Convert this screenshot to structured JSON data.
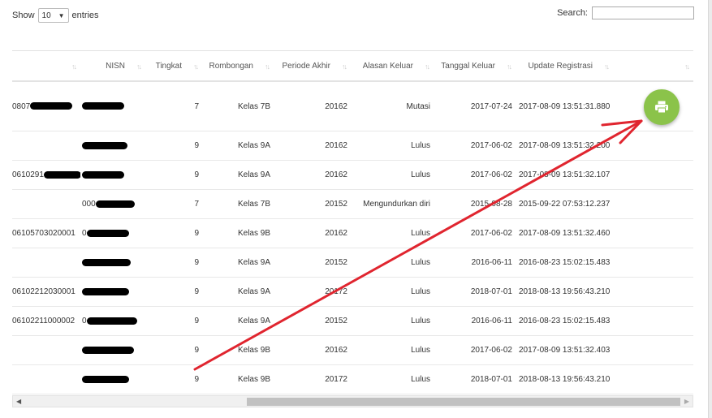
{
  "length": {
    "show_label": "Show",
    "value": "10",
    "entries_label": "entries"
  },
  "search": {
    "label": "Search:",
    "value": ""
  },
  "table": {
    "headers": [
      "",
      "NISN",
      "Tingkat",
      "Rombongan",
      "Periode Akhir",
      "Alasan Keluar",
      "Tanggal Keluar",
      "Update Registrasi",
      ""
    ],
    "rows": [
      {
        "nipd": "0807",
        "nisn": "",
        "tingkat": "7",
        "rombongan": "Kelas 7B",
        "periode": "20162",
        "alasan": "Mutasi",
        "tanggal": "2017-07-24",
        "update": "2017-08-09 13:51:31.880"
      },
      {
        "nipd": "",
        "nisn": "",
        "tingkat": "9",
        "rombongan": "Kelas 9A",
        "periode": "20162",
        "alasan": "Lulus",
        "tanggal": "2017-06-02",
        "update": "2017-08-09 13:51:32.200"
      },
      {
        "nipd": "0610291",
        "nisn": "",
        "tingkat": "9",
        "rombongan": "Kelas 9A",
        "periode": "20162",
        "alasan": "Lulus",
        "tanggal": "2017-06-02",
        "update": "2017-08-09 13:51:32.107"
      },
      {
        "nipd": "",
        "nisn": "000",
        "tingkat": "7",
        "rombongan": "Kelas 7B",
        "periode": "20152",
        "alasan": "Mengundurkan diri",
        "tanggal": "2015-08-28",
        "update": "2015-09-22 07:53:12.237"
      },
      {
        "nipd": "06105703020001",
        "nisn": "0",
        "tingkat": "9",
        "rombongan": "Kelas 9B",
        "periode": "20162",
        "alasan": "Lulus",
        "tanggal": "2017-06-02",
        "update": "2017-08-09 13:51:32.460"
      },
      {
        "nipd": "",
        "nisn": "",
        "tingkat": "9",
        "rombongan": "Kelas 9A",
        "periode": "20152",
        "alasan": "Lulus",
        "tanggal": "2016-06-11",
        "update": "2016-08-23 15:02:15.483"
      },
      {
        "nipd": "06102212030001",
        "nisn": "",
        "tingkat": "9",
        "rombongan": "Kelas 9A",
        "periode": "20172",
        "alasan": "Lulus",
        "tanggal": "2018-07-01",
        "update": "2018-08-13 19:56:43.210"
      },
      {
        "nipd": "06102211000002",
        "nisn": "0",
        "tingkat": "9",
        "rombongan": "Kelas 9A",
        "periode": "20152",
        "alasan": "Lulus",
        "tanggal": "2016-06-11",
        "update": "2016-08-23 15:02:15.483"
      },
      {
        "nipd": "",
        "nisn": "",
        "tingkat": "9",
        "rombongan": "Kelas 9B",
        "periode": "20162",
        "alasan": "Lulus",
        "tanggal": "2017-06-02",
        "update": "2017-08-09 13:51:32.403"
      },
      {
        "nipd": "",
        "nisn": "",
        "tingkat": "9",
        "rombongan": "Kelas 9B",
        "periode": "20172",
        "alasan": "Lulus",
        "tanggal": "2018-07-01",
        "update": "2018-08-13 19:56:43.210"
      }
    ]
  },
  "print_button": {
    "icon": "printer-icon",
    "color": "#8bc34a"
  },
  "annotation": {
    "color": "#e0252f"
  }
}
